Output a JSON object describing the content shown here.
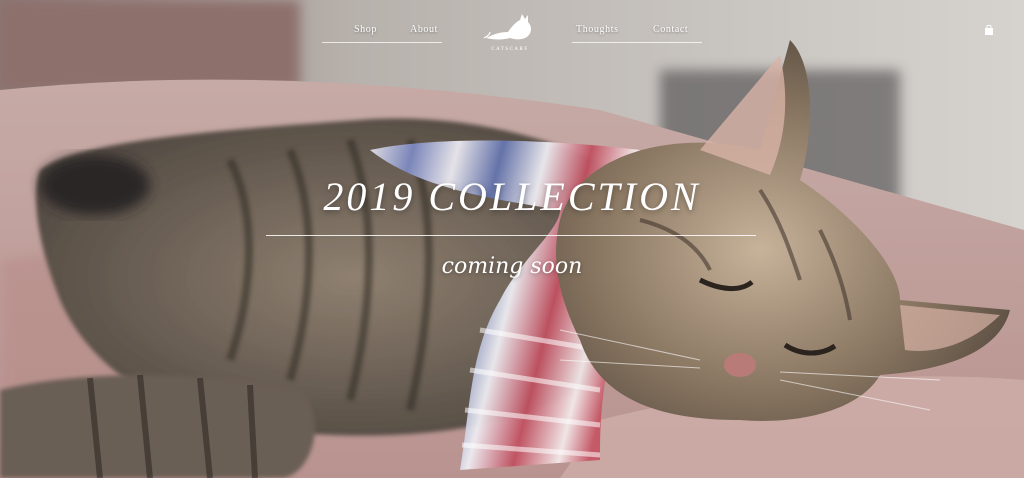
{
  "nav": {
    "items": [
      {
        "label": "Shop"
      },
      {
        "label": "About"
      },
      {
        "label": "Thoughts"
      },
      {
        "label": "Contact"
      }
    ],
    "logo_text": "CATSCARF",
    "cart_icon": "shopping-bag-icon"
  },
  "hero": {
    "headline": "2019 COLLECTION",
    "subline": "coming soon",
    "image": "sleeping tabby cat wearing knitted striped scarf on pink blanket"
  },
  "colors": {
    "text": "#ffffff",
    "blanket": "#c9a8a4",
    "scarf_red": "#c24a5a",
    "scarf_blue": "#6d7fb3"
  }
}
